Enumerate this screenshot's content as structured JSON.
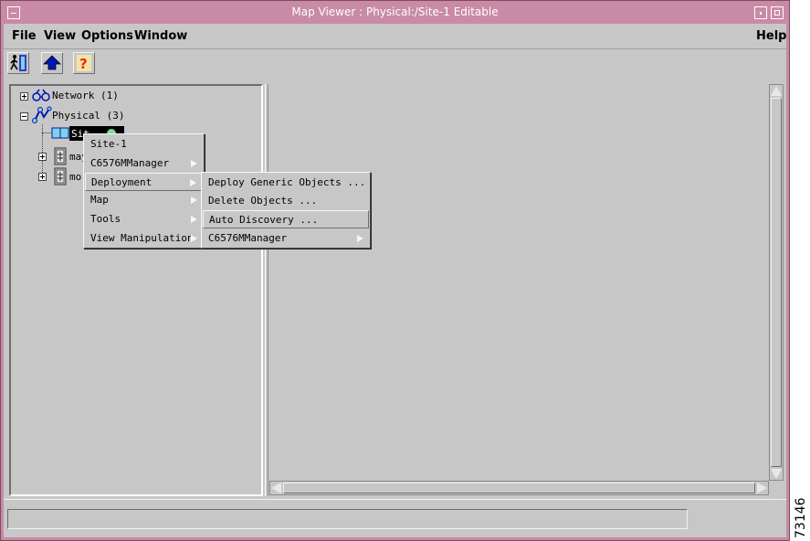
{
  "window": {
    "title": "Map Viewer : Physical:/Site-1     Editable"
  },
  "menubar": {
    "file": "File",
    "view": "View",
    "options": "Options",
    "window": "Window",
    "help": "Help"
  },
  "toolbar": {
    "icons": [
      "exit-icon",
      "up-arrow-icon",
      "help-icon"
    ]
  },
  "tree": {
    "network": "Network (1)",
    "physical": "Physical (3)",
    "site1_partial": "Sit",
    "may_partial": "may",
    "mor_partial": "mor"
  },
  "context_menu": {
    "items": [
      "Site-1",
      "C6576MManager",
      "Deployment",
      "Map",
      "Tools",
      "View Manipulation"
    ]
  },
  "deployment_submenu": {
    "items": [
      "Deploy Generic Objects ...",
      "Delete Objects ...",
      "Auto Discovery ...",
      "C6576MManager"
    ]
  },
  "side_code": "73146",
  "colors": {
    "titlebar": "#c98aa5",
    "panel": "#c7c7c7",
    "selection": "#000000"
  }
}
